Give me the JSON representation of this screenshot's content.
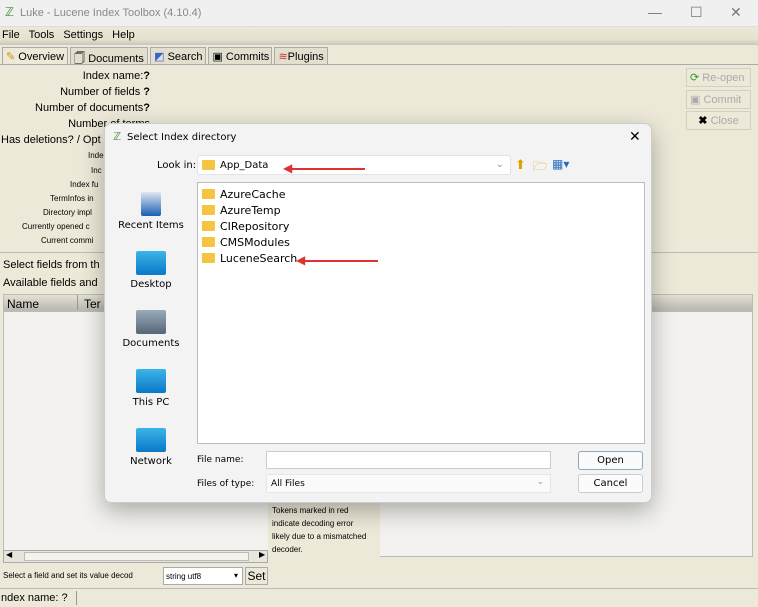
{
  "window": {
    "title": "Luke - Lucene Index Toolbox (4.10.4)",
    "min": "—",
    "max": "☐",
    "close": "✕"
  },
  "menu": [
    "File",
    "Tools",
    "Settings",
    "Help"
  ],
  "tabs": [
    "Overview",
    "Documents",
    "Search",
    "Commits",
    "Plugins"
  ],
  "overview": {
    "labels": [
      "Index name:",
      "Number of fields",
      "Number of documents",
      "Number of terms",
      "Has deletions? / Opt",
      "Inde",
      "Inc",
      "Index fu",
      "TermInfos in",
      "Directory impl",
      "Currently opened c",
      "Current commi"
    ],
    "unknown": "?",
    "select_fields": "Select fields from th",
    "available_fields": "Available fields and",
    "columns": [
      "Name",
      "Ter"
    ],
    "tokens_note": "Tokens marked in red indicate decoding error likely due to a mismatched decoder.",
    "decoder_label": "Select a field and set its value decod",
    "decoder_value": "string utf8",
    "set_button": "Set"
  },
  "right_buttons": [
    "Re-open",
    "Commit",
    "Close"
  ],
  "status": {
    "text": "ndex name: ?"
  },
  "dialog": {
    "title": "Select Index directory",
    "look_in_label": "Look in:",
    "look_in_value": "App_Data",
    "places": [
      "Recent Items",
      "Desktop",
      "Documents",
      "This PC",
      "Network"
    ],
    "folders": [
      "AzureCache",
      "AzureTemp",
      "CIRepository",
      "CMSModules",
      "LuceneSearch"
    ],
    "file_name_label": "File name:",
    "file_name_value": "",
    "file_type_label": "Files of type:",
    "file_type_value": "All Files",
    "open": "Open",
    "cancel": "Cancel",
    "close": "✕"
  },
  "colors": {
    "annotation_arrow": "#dd3333",
    "background": "#ece9d8"
  }
}
